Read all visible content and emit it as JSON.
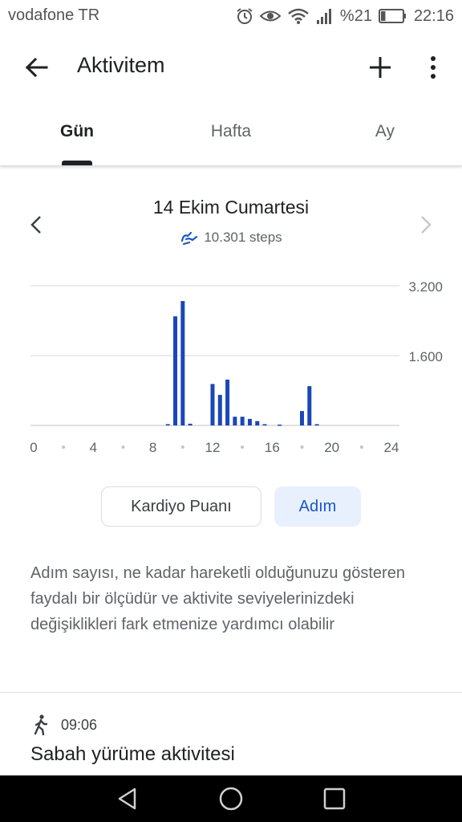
{
  "status": {
    "carrier": "vodafone TR",
    "battery_percent": "%21",
    "time": "22:16",
    "battery_level": 0.21,
    "icons": [
      "alarm-icon",
      "eye-icon",
      "wifi-icon",
      "signal-icon",
      "battery-icon"
    ]
  },
  "appbar": {
    "title": "Aktivitem",
    "back_icon": "arrow-back-icon",
    "add_icon": "plus-icon",
    "more_icon": "more-vert-icon"
  },
  "tabs": [
    {
      "label": "Gün",
      "active": true
    },
    {
      "label": "Hafta",
      "active": false
    },
    {
      "label": "Ay",
      "active": false
    }
  ],
  "day": {
    "date": "14 Ekim Cumartesi",
    "steps": "10.301 steps"
  },
  "chart_data": {
    "type": "bar",
    "x": [
      9,
      9.5,
      10,
      10.5,
      12,
      12.5,
      13,
      13.5,
      14,
      14.5,
      15,
      15.5,
      16.5,
      18,
      18.5,
      19
    ],
    "values": [
      30,
      2500,
      2850,
      40,
      950,
      700,
      1050,
      200,
      200,
      150,
      100,
      30,
      20,
      330,
      900,
      30
    ],
    "xlim": [
      0,
      24
    ],
    "ylim": [
      0,
      3200
    ],
    "x_ticks": [
      "0",
      "4",
      "8",
      "12",
      "16",
      "20",
      "24"
    ],
    "y_ticks": [
      "1.600",
      "3.200"
    ],
    "bar_color": "#1a47b8",
    "grid": true
  },
  "toggle": {
    "kardiyo": "Kardiyo Puanı",
    "adim": "Adım"
  },
  "description": "Adım sayısı, ne kadar hareketli olduğunuzu gösteren faydalı bir ölçüdür ve aktivite seviyelerinizdeki değişiklikleri fark etmenize yardımcı olabilir",
  "activity": {
    "time": "09:06",
    "title": "Sabah yürüme aktivitesi",
    "icon": "walking-icon"
  },
  "navbar": {
    "icons": [
      "back-triangle-icon",
      "home-circle-icon",
      "recents-square-icon"
    ]
  },
  "colors": {
    "accent": "#1a56c4",
    "accent_bg": "#e8f0fe",
    "bar": "#1a47b8"
  }
}
